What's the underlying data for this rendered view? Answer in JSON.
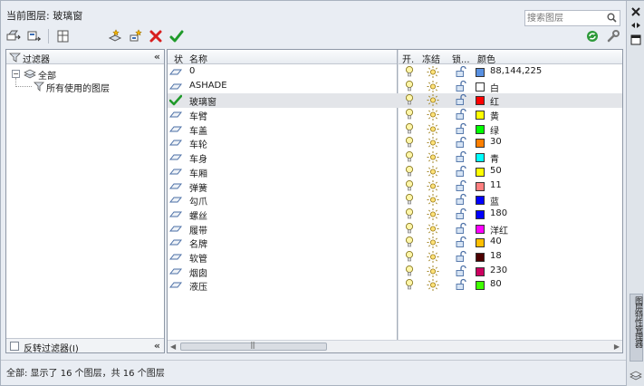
{
  "header": {
    "current_layer_label": "当前图层:",
    "current_layer_value": "玻璃窗",
    "search_placeholder": "搜索图层"
  },
  "toolbar": {
    "left_icons": [
      "new-property-filter-icon",
      "new-group-filter-icon",
      "layer-states-manager-icon"
    ],
    "mid_icons": [
      "new-layer-icon",
      "new-layer-vp-frozen-icon",
      "delete-layer-icon",
      "set-current-icon"
    ],
    "right_icons": [
      "refresh-icon",
      "settings-icon"
    ]
  },
  "filter_panel": {
    "title": "过滤器",
    "tree": [
      {
        "label": "全部",
        "level": 0
      },
      {
        "label": "所有使用的图层",
        "level": 1
      }
    ],
    "invert_label": "反转过滤器(I)"
  },
  "grid": {
    "columns": {
      "status": "状",
      "name": "名称",
      "on": "开.",
      "freeze": "冻结",
      "lock": "锁...",
      "color": "颜色"
    },
    "rows": [
      {
        "name": "0",
        "color": "88,144,225",
        "swatch": "#5890e1",
        "current": false
      },
      {
        "name": "ASHADE",
        "color": "白",
        "swatch": "#ffffff",
        "current": false
      },
      {
        "name": "玻璃窗",
        "color": "红",
        "swatch": "#ff0000",
        "current": true
      },
      {
        "name": "车臂",
        "color": "黄",
        "swatch": "#ffff00",
        "current": false
      },
      {
        "name": "车盖",
        "color": "绿",
        "swatch": "#00ff00",
        "current": false
      },
      {
        "name": "车轮",
        "color": "30",
        "swatch": "#ff7f00",
        "current": false
      },
      {
        "name": "车身",
        "color": "青",
        "swatch": "#00ffff",
        "current": false
      },
      {
        "name": "车厢",
        "color": "50",
        "swatch": "#ffff00",
        "current": false
      },
      {
        "name": "弹簧",
        "color": "11",
        "swatch": "#ff7f7f",
        "current": false
      },
      {
        "name": "勾爪",
        "color": "蓝",
        "swatch": "#0000ff",
        "current": false
      },
      {
        "name": "螺丝",
        "color": "180",
        "swatch": "#0000ff",
        "current": false
      },
      {
        "name": "履带",
        "color": "洋红",
        "swatch": "#ff00ff",
        "current": false
      },
      {
        "name": "名牌",
        "color": "40",
        "swatch": "#ffbf00",
        "current": false
      },
      {
        "name": "软管",
        "color": "18",
        "swatch": "#4c0000",
        "current": false
      },
      {
        "name": "烟囱",
        "color": "230",
        "swatch": "#cc005f",
        "current": false
      },
      {
        "name": "液压",
        "color": "80",
        "swatch": "#3fff00",
        "current": false
      }
    ]
  },
  "status_text": "全部: 显示了 16 个图层，共 16 个图层",
  "side_title": "图层特性管理器"
}
